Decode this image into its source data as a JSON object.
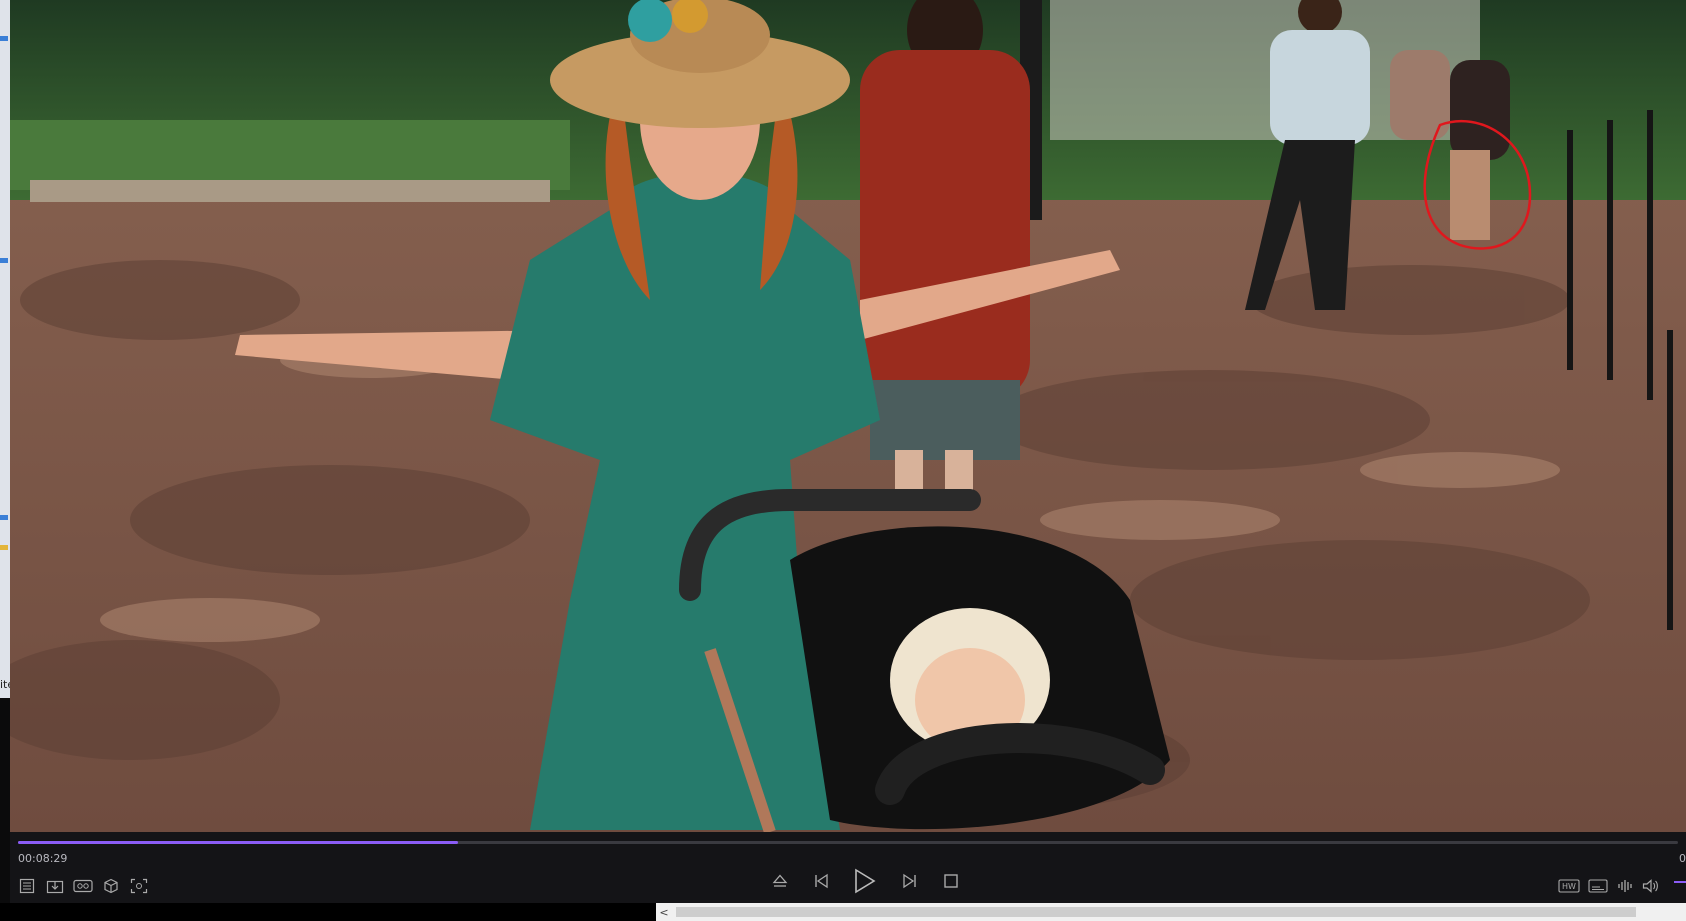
{
  "player": {
    "current_time": "00:08:29",
    "end_time": "0",
    "progress": 0.265,
    "accent_color": "#8b5cf6",
    "left_controls": [
      {
        "name": "playlist-icon"
      },
      {
        "name": "download-icon"
      },
      {
        "name": "vr-icon"
      },
      {
        "name": "3d-cube-icon"
      },
      {
        "name": "screenshot-icon"
      }
    ],
    "center_controls": [
      {
        "name": "eject-icon"
      },
      {
        "name": "previous-icon"
      },
      {
        "name": "play-icon"
      },
      {
        "name": "next-icon"
      },
      {
        "name": "stop-icon"
      }
    ],
    "right_controls": [
      {
        "name": "hw-decode-icon",
        "label": "HW"
      },
      {
        "name": "subtitles-icon"
      },
      {
        "name": "audio-track-icon"
      },
      {
        "name": "volume-icon"
      }
    ]
  },
  "scrollbar": {
    "left_arrow": "<"
  },
  "desktop_strip": {
    "edge_text": "ite"
  }
}
